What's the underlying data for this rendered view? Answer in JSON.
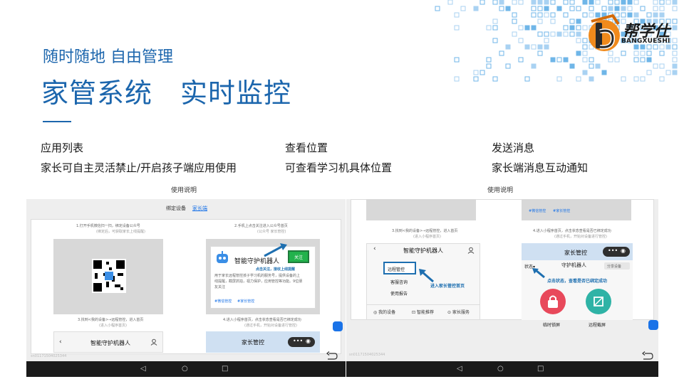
{
  "header": {
    "subtitle": "随时随地 自由管理",
    "title": "家管系统　实时监控"
  },
  "logo": {
    "cn": "帮学仕",
    "en": "BANGXUESHI"
  },
  "features": [
    {
      "title": "应用列表",
      "desc": "家长可自主灵活禁止/开启孩子端应用使用"
    },
    {
      "title": "查看位置",
      "desc": "可查看学习机具体位置"
    },
    {
      "title": "发送消息",
      "desc": "家长端消息互动通知"
    }
  ],
  "screen_left": {
    "caption": "使用说明",
    "tabs": {
      "a": "绑定设备",
      "b": "家长端"
    },
    "step1": "1.打开手机微信扫一扫，绑定设备公众号",
    "step1_sub": "(绑定后，可获取家长上线提醒)",
    "step2": "2.手机上点击关注进入公众号首页",
    "step2_sub": "(公众号 家长管控)",
    "robot_name": "智能守护机器人",
    "follow_btn": "关注",
    "robot_hint": "点击关注，接收上线提醒",
    "robot_desc": "用于家长远程管控孩子学习机的服务号，提供设备的上线提醒，截屏抓拍，视力保护，应用管控等功能。9位朋友关注",
    "tag1": "#微信管控",
    "tag2": "#家长管控",
    "step3": "3.找到<我的设备>→远程管控，进入首页",
    "step3_sub": "(进入小程序首页)",
    "step4": "4.进入小程序首页，点击状态查看是否已绑定成功",
    "step4_sub": "(通过手机，开始对设备进行管控)",
    "mini_title": "智能守护机器人",
    "mini_blue_title": "家长管控",
    "footer_id": "sn01171504025344"
  },
  "screen_right": {
    "caption": "使用说明",
    "tag1": "#微信管控",
    "tag2": "#家长管控",
    "step3": "3.找到<我的设备>→远程管控，进入首页",
    "step3_sub": "(进入小程序首页)",
    "mini_title": "智能守护机器人",
    "menu_remote": "远程管控",
    "menu_consult": "客服咨询",
    "menu_report": "使用报告",
    "annotation": "进入家长管控首页",
    "bottom_tabs": [
      "我的设备",
      "智能推荐",
      "家长服务"
    ],
    "step4": "4.进入小程序首页，点击状态查看是否已绑定成功",
    "step4_sub": "(通过手机，开始对设备进行管控)",
    "blue_title": "家长管控",
    "status_label": "状态",
    "robot_label": "守护机器人",
    "share_btn": "分享设备",
    "hint": "点击状态，查看是否已绑定成功",
    "lock_label": "临时锁屏",
    "shot_label": "远程截屏",
    "footer_id": "sn01171504025344"
  },
  "colors": {
    "accent": "#1c66ad",
    "lock": "#e8495b",
    "shot": "#2fb3a6"
  }
}
